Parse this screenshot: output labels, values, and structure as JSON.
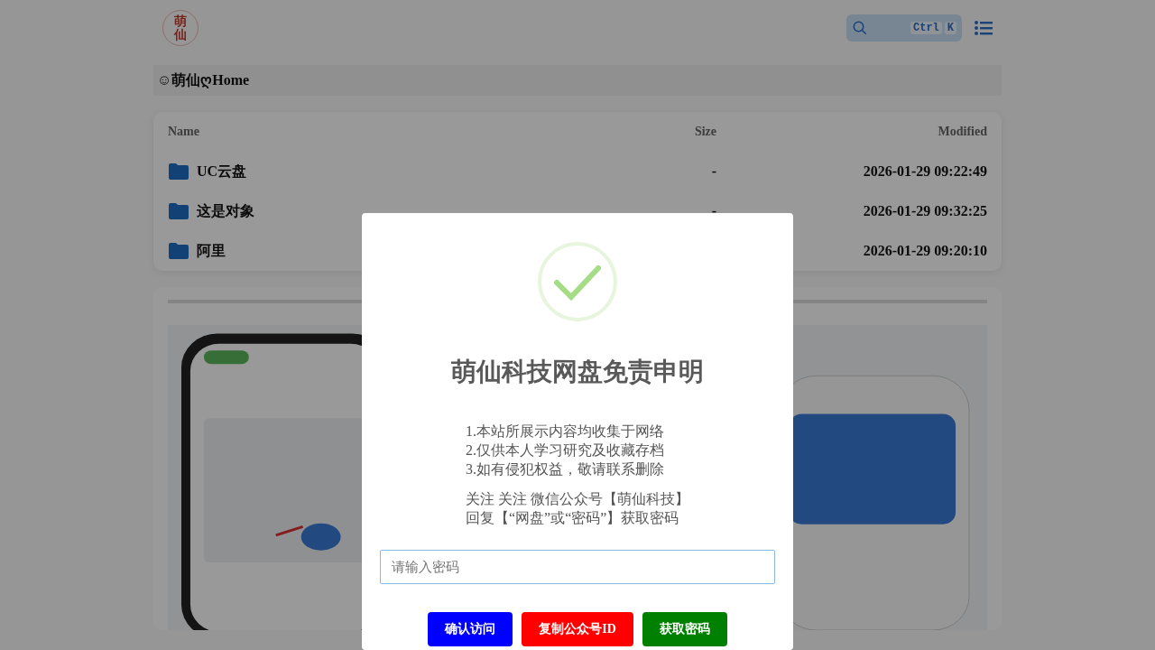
{
  "header": {
    "logo_text": "萌仙",
    "search_keys": [
      "Ctrl",
      "K"
    ]
  },
  "breadcrumb": "☺萌仙ღHome",
  "table": {
    "columns": [
      "Name",
      "Size",
      "Modified"
    ],
    "rows": [
      {
        "name": "UC云盘",
        "size": "-",
        "modified": "2026-01-29 09:22:49"
      },
      {
        "name": "这是对象",
        "size": "-",
        "modified": "2026-01-29 09:32:25"
      },
      {
        "name": "阿里",
        "modified": "2026-01-29 09:20:10"
      }
    ]
  },
  "dialog": {
    "title": "萌仙科技网盘免责申明",
    "lines": [
      "1.本站所展示内容均收集于网络",
      "2.仅供本人学习研究及收藏存档",
      "3.如有侵犯权益，敬请联系删除"
    ],
    "notes": [
      "关注 关注 微信公众号【萌仙科技】",
      "回复【“网盘”或“密码”】获取密码"
    ],
    "password": {
      "placeholder": "请输入密码"
    },
    "buttons": [
      {
        "label": "确认访问",
        "color": "#0000ff"
      },
      {
        "label": "复制公众号ID",
        "color": "#ff0000"
      },
      {
        "label": "获取密码",
        "color": "#008000"
      }
    ]
  }
}
